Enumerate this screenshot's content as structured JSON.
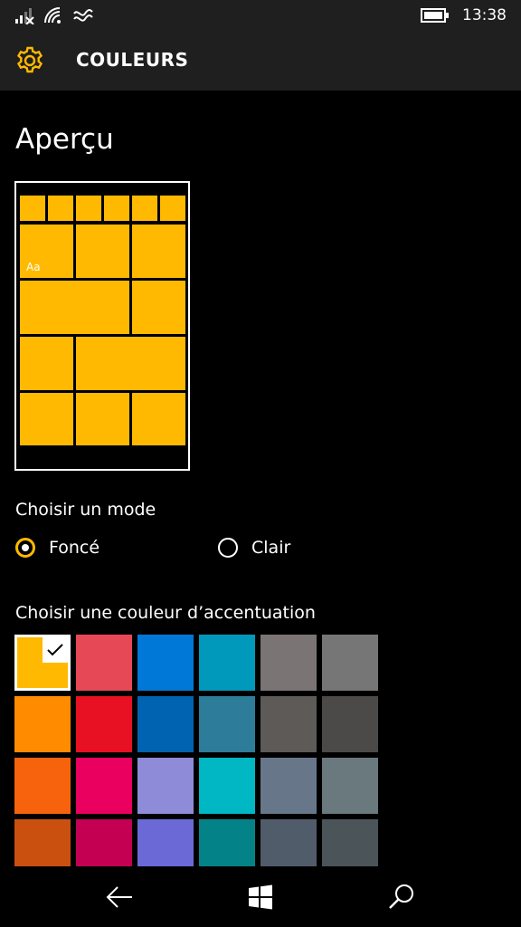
{
  "status_bar": {
    "time": "13:38"
  },
  "header": {
    "title": "COULEURS",
    "accent": "#ffb900"
  },
  "preview": {
    "heading": "Aperçu",
    "tile_text": "Aa",
    "tile_color": "#ffb900"
  },
  "mode": {
    "label": "Choisir un mode",
    "options": [
      {
        "label": "Foncé",
        "selected": true
      },
      {
        "label": "Clair",
        "selected": false
      }
    ]
  },
  "accent": {
    "label": "Choisir une couleur d’accentuation",
    "selected_index": 0,
    "swatches": [
      "#ffb900",
      "#e74856",
      "#0078d7",
      "#0099bc",
      "#7a7574",
      "#767676",
      "#ff8c00",
      "#e81123",
      "#0063b1",
      "#2d7d9a",
      "#5d5a58",
      "#4c4a48",
      "#f7630c",
      "#ea005e",
      "#8e8cd8",
      "#00b7c3",
      "#68768a",
      "#69797e",
      "#ca5010",
      "#c30052",
      "#6b69d6",
      "#038387",
      "#515c6b",
      "#4a5459"
    ]
  }
}
